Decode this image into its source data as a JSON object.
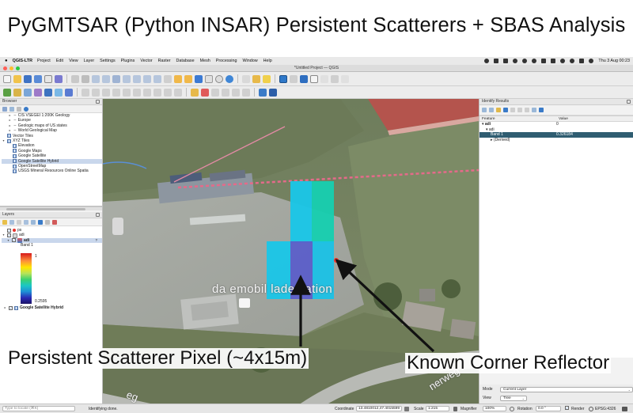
{
  "slide": {
    "title": "PyGMTSAR (Python INSAR) Persistent Scatterers + SBAS Analysis"
  },
  "menubar": {
    "app": "QGIS-LTR",
    "menus": [
      "Project",
      "Edit",
      "View",
      "Layer",
      "Settings",
      "Plugins",
      "Vector",
      "Raster",
      "Database",
      "Mesh",
      "Processing",
      "Window",
      "Help"
    ],
    "clock": "Thu 3 Aug  00:23"
  },
  "window": {
    "title": "*Untitled Project — QGIS"
  },
  "browser_panel": {
    "title": "Browser",
    "items": [
      {
        "label": "CIS VSEGEI 1:200K Geology",
        "level": 1,
        "kind": "wms"
      },
      {
        "label": "Europe",
        "level": 1,
        "kind": "wms"
      },
      {
        "label": "Geologic maps of US states",
        "level": 1,
        "kind": "wms"
      },
      {
        "label": "World Geological Map",
        "level": 1,
        "kind": "wms"
      },
      {
        "label": "Vector Tiles",
        "level": 0,
        "kind": "grid"
      },
      {
        "label": "XYZ Tiles",
        "level": 0,
        "kind": "grid"
      },
      {
        "label": "Elevation",
        "level": 2,
        "kind": "grid"
      },
      {
        "label": "Google Maps",
        "level": 2,
        "kind": "grid"
      },
      {
        "label": "Google Satellite",
        "level": 2,
        "kind": "grid"
      },
      {
        "label": "Google Satellite Hybrid",
        "level": 2,
        "kind": "grid",
        "selected": true
      },
      {
        "label": "OpenStreetMap",
        "level": 2,
        "kind": "grid"
      },
      {
        "label": "USGS Mineral Resources Online Spatia",
        "level": 2,
        "kind": "grid"
      }
    ]
  },
  "layers_panel": {
    "title": "Layers",
    "layers": [
      {
        "label": "ps",
        "checked": true
      },
      {
        "label": "adi",
        "checked": true
      },
      {
        "label": "adi",
        "checked": true,
        "selected": true
      }
    ],
    "band_label": "Band 1",
    "legend_max": "1",
    "legend_min": "0.2595",
    "basemap": "Google Satellite Hybrid"
  },
  "identify_panel": {
    "title": "Identify Results",
    "col_feature": "Feature",
    "col_value": "Value",
    "rows": [
      {
        "feature": "adi",
        "value": "0"
      },
      {
        "feature": "adi",
        "value": ""
      },
      {
        "feature": "Band 1",
        "value": "0.326184",
        "selected": true
      },
      {
        "feature": "(Derived)",
        "value": ""
      }
    ],
    "mode_label": "Mode",
    "mode_value": "Current Layer",
    "view_label": "View",
    "view_value": "Tree"
  },
  "map": {
    "place_label": "da emobil ladestation",
    "road_label": "nerweg",
    "colors": {
      "pixel_light": "#19c6e8",
      "pixel_green": "#16cfb0",
      "pixel_purple": "#5c5fc9",
      "reflector": "#e8332c"
    }
  },
  "annotations": {
    "ps_pixel": "Persistent Scatterer Pixel (~4x15m)",
    "corner_reflector": "Known Corner Reflector"
  },
  "statusbar": {
    "locate_placeholder": "Type to locate (⌘K)",
    "message": "Identifying done.",
    "coordinate_label": "Coordinate",
    "coordinate_value": "13.4810012,47.4015599",
    "scale_label": "Scale",
    "scale_value": "1:215",
    "magnifier_label": "Magnifier",
    "magnifier_value": "100%",
    "rotation_label": "Rotation",
    "rotation_value": "0.0 °",
    "render_label": "Render",
    "crs": "EPSG:4326"
  }
}
